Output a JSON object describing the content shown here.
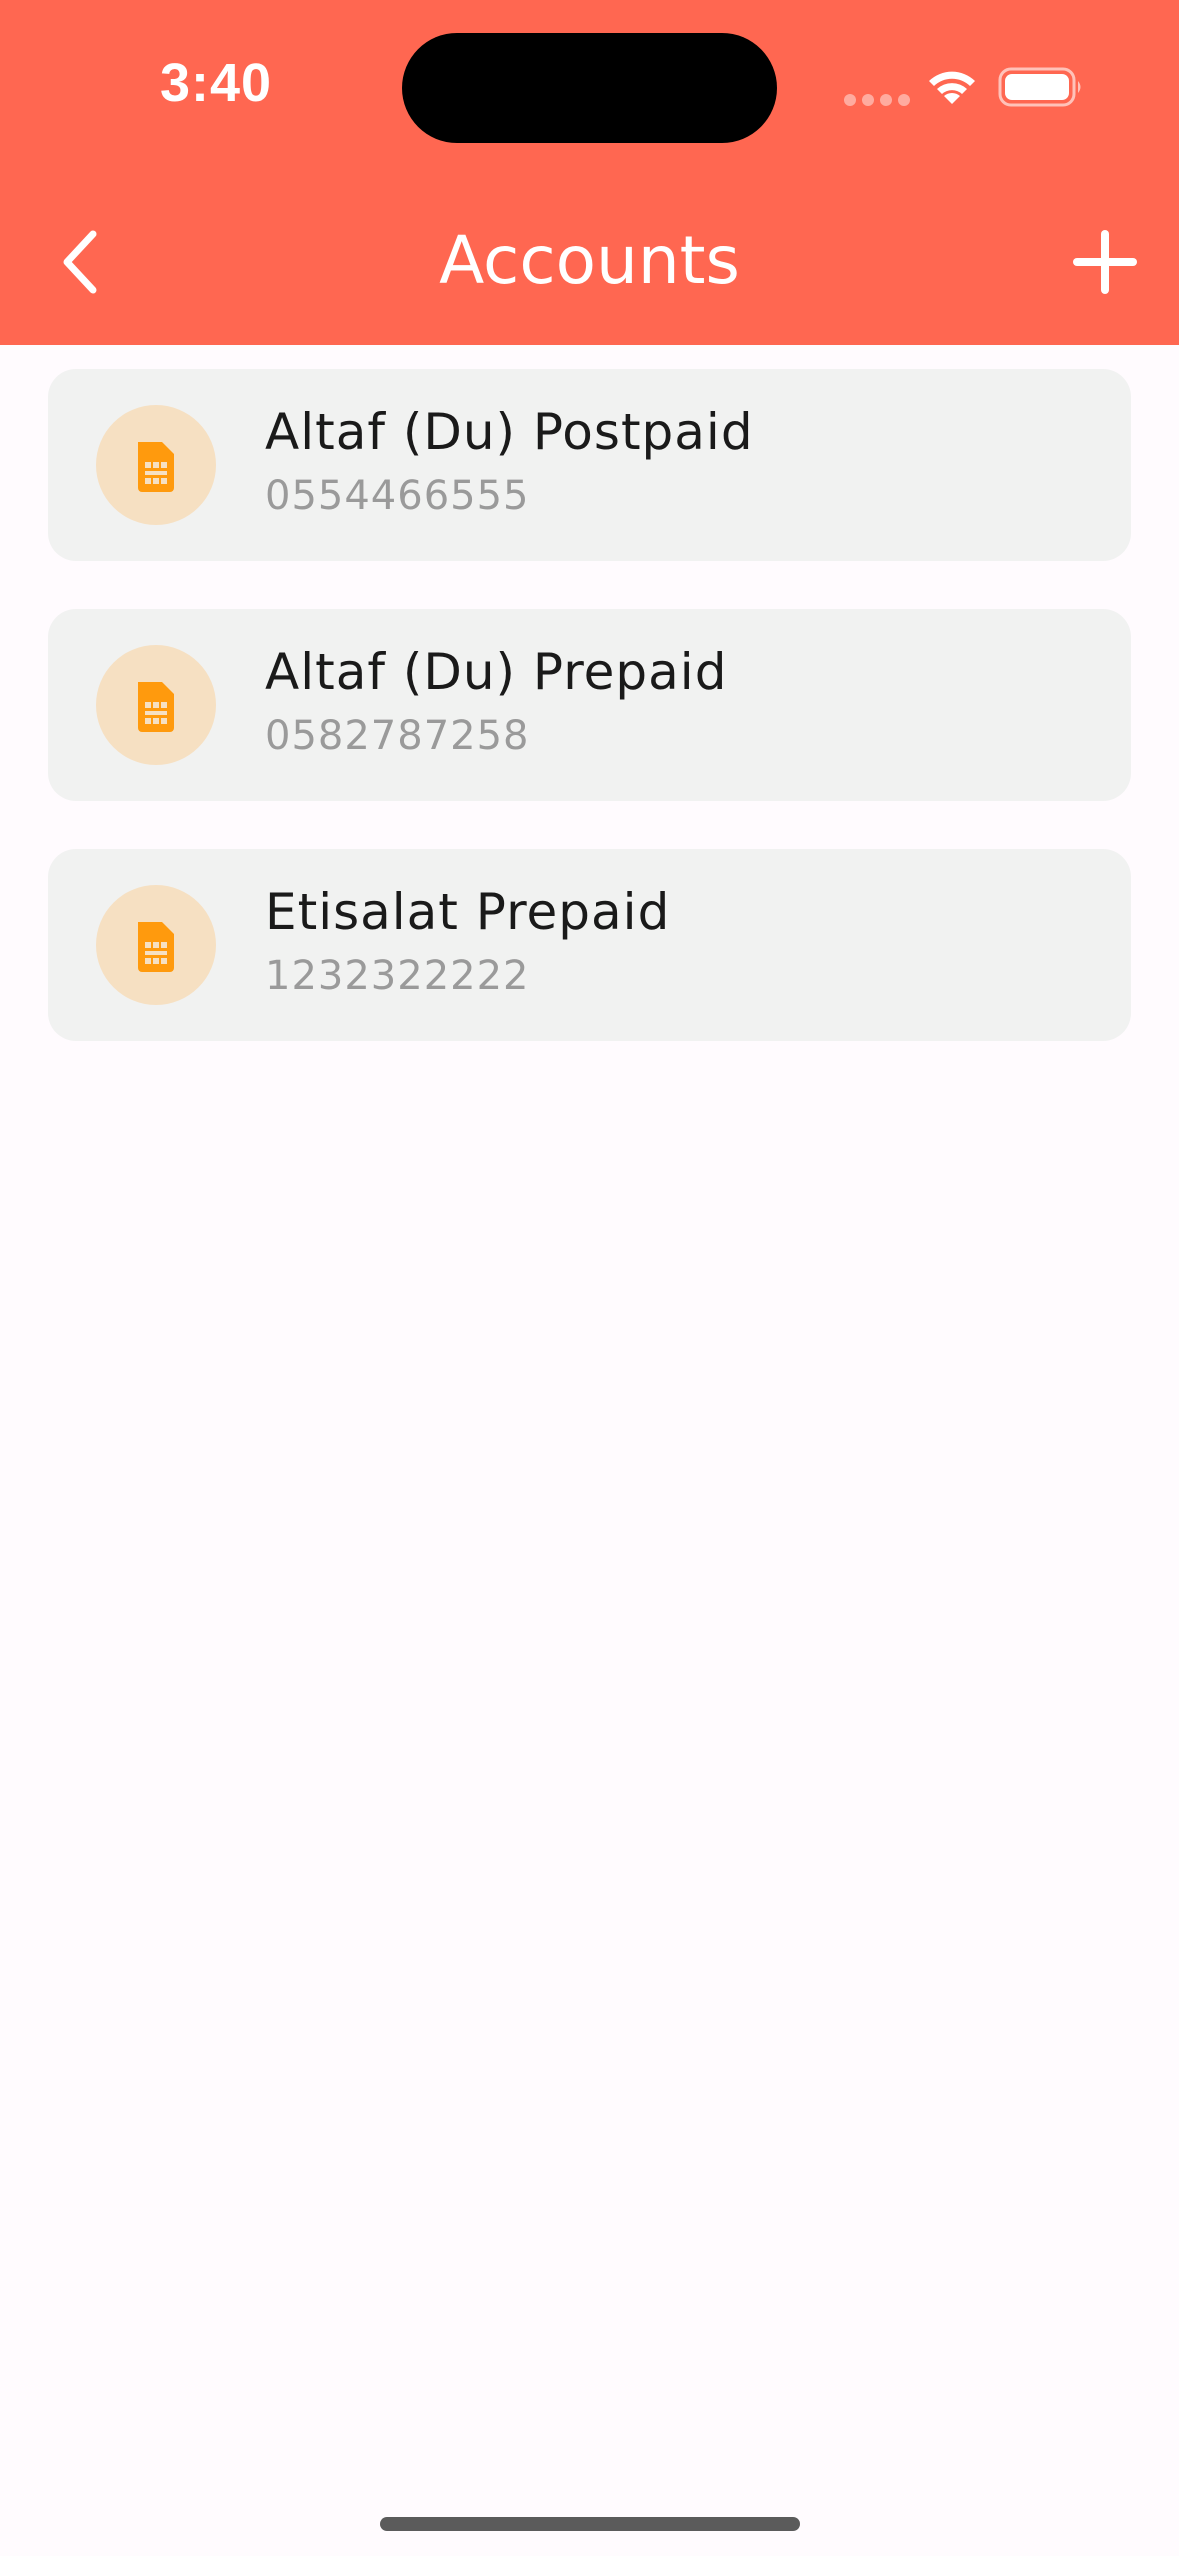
{
  "status_bar": {
    "time": "3:40",
    "icons": [
      "signal-icon",
      "wifi-icon",
      "battery-icon"
    ]
  },
  "header": {
    "title": "Accounts",
    "back_icon": "chevron-left-icon",
    "add_icon": "plus-icon"
  },
  "accounts": [
    {
      "name": "Altaf (Du) Postpaid",
      "number": "0554466555",
      "icon": "sim-card-icon"
    },
    {
      "name": "Altaf (Du) Prepaid",
      "number": "0582787258",
      "icon": "sim-card-icon"
    },
    {
      "name": "Etisalat Prepaid",
      "number": "1232322222",
      "icon": "sim-card-icon"
    }
  ],
  "colors": {
    "header_bg": "#FF6751",
    "card_bg": "#F1F2F1",
    "icon_circle": "#F6E0C2",
    "icon_accent": "#FF9A0D"
  }
}
